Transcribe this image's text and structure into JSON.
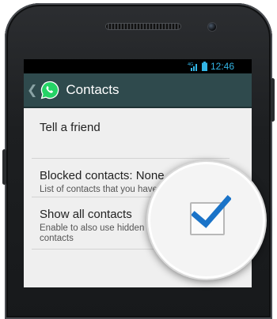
{
  "status_bar": {
    "network": "4G",
    "time": "12:46"
  },
  "action_bar": {
    "title": "Contacts"
  },
  "items": [
    {
      "title": "Tell a friend"
    },
    {
      "title": "Blocked contacts: None",
      "subtitle": "List of contacts that you have bl"
    },
    {
      "title": "Show all contacts",
      "subtitle": "Enable to also use hidden contacts",
      "checked": true
    }
  ],
  "colors": {
    "status_accent": "#33b5e5",
    "action_bar": "#2f4a4d",
    "whatsapp_green": "#25d366",
    "checkmark": "#1a73c8"
  }
}
